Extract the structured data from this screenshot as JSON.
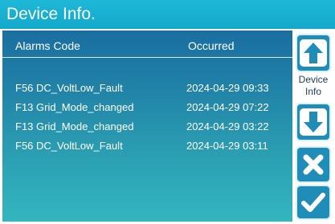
{
  "title": "Device Info.",
  "table": {
    "col_code": "Alarms Code",
    "col_time": "Occurred",
    "rows": [
      {
        "code": "F56 DC_VoltLow_Fault",
        "time": "2024-04-29  09:33"
      },
      {
        "code": "F13 Grid_Mode_changed",
        "time": "2024-04-29  07:22"
      },
      {
        "code": "F13 Grid_Mode_changed",
        "time": "2024-04-29  03:22"
      },
      {
        "code": "F56 DC_VoltLow_Fault",
        "time": "2024-04-29  03:11"
      }
    ]
  },
  "sidebar": {
    "label_line1": "Device",
    "label_line2": "Info",
    "icons": [
      "arrow-up-icon",
      "arrow-down-icon",
      "close-icon",
      "check-icon"
    ]
  },
  "colors": {
    "title_bar": "#1fb7d8",
    "panel_top": "#1a6ea0",
    "panel_bottom": "#34b6be",
    "button": "#1f8db8"
  }
}
